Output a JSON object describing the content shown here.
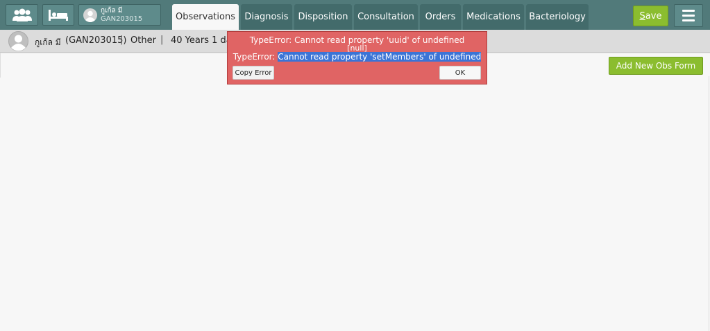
{
  "header": {
    "patient_button": {
      "name": "กูเก้ล มี",
      "id": "GAN203015"
    },
    "tabs": [
      {
        "label": "Observations",
        "active": true
      },
      {
        "label": "Diagnosis",
        "active": false
      },
      {
        "label": "Disposition",
        "active": false
      },
      {
        "label": "Consultation",
        "active": false
      },
      {
        "label": "Orders",
        "active": false
      },
      {
        "label": "Medications",
        "active": false
      },
      {
        "label": "Bacteriology",
        "active": false
      }
    ],
    "save": {
      "accel": "S",
      "rest": "ave"
    },
    "icons": {
      "patients": "patients-group-icon",
      "bed": "bed-icon",
      "avatar": "user-avatar-icon",
      "menu": "hamburger-menu-icon"
    }
  },
  "patient_info": {
    "name": "กูเก้ล มี",
    "id": "(GAN203015)",
    "separator": "|",
    "gender": "Other",
    "age": "40 Years 1 days"
  },
  "main": {
    "add_obs_label": "Add New Obs Form"
  },
  "error_dialog": {
    "line1": "TypeError: Cannot read property 'uuid' of undefined",
    "line2": "[null]",
    "line3_prefix": "TypeError: ",
    "line3_selected": "Cannot read property 'setMembers' of undefined",
    "copy_label": "Copy Error",
    "ok_label": "OK"
  },
  "colors": {
    "header_bg": "#517a7a",
    "tab_bg": "#436b6b",
    "accent_green": "#8bbd2f",
    "error_bg": "#e06464",
    "selection": "#3b74d6"
  }
}
